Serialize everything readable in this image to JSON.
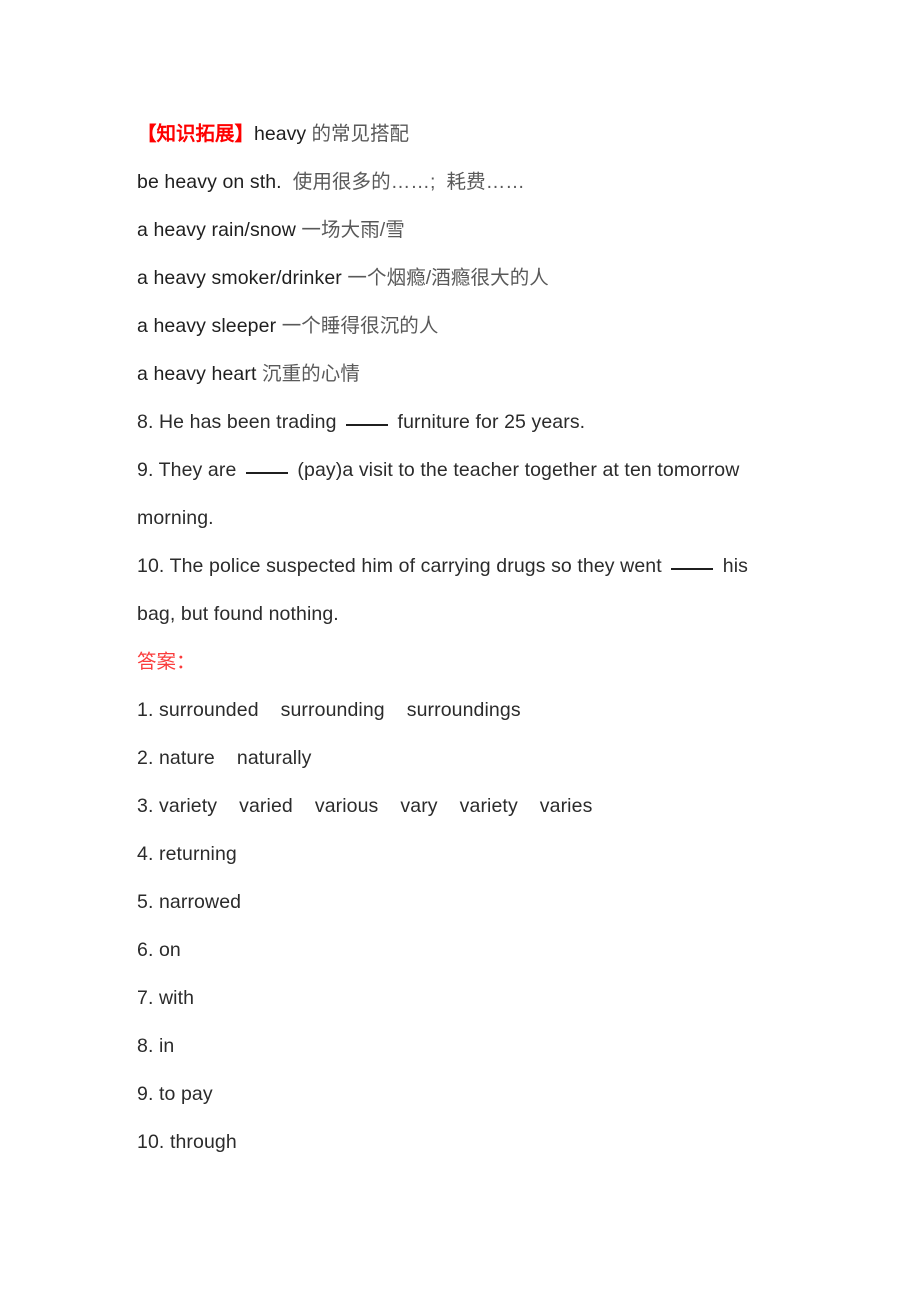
{
  "document": {
    "background_color": "#ffffff",
    "text_color": "#2b2b2b",
    "accent_red": "#ff0000",
    "answer_red": "#fa3c3c"
  },
  "knowledge_note": {
    "bracket_open": "【",
    "label": "知识拓展",
    "bracket_close": "】",
    "title_en": "heavy",
    "title_zh": " 的常见搭配",
    "collocations": [
      {
        "en": "be heavy on sth.",
        "zh": "  使用很多的……;  耗费……"
      },
      {
        "en": "a heavy rain/snow",
        "zh": " 一场大雨/雪"
      },
      {
        "en": "a heavy smoker/drinker",
        "zh": " 一个烟瘾/酒瘾很大的人"
      },
      {
        "en": "a heavy sleeper",
        "zh": " 一个睡得很沉的人"
      },
      {
        "en": "a heavy heart",
        "zh": " 沉重的心情"
      }
    ]
  },
  "questions": [
    {
      "number": "8.",
      "part1": " He has been trading ",
      "part2": " furniture for 25 years.",
      "part3": ""
    },
    {
      "number": "9.",
      "part1": " They are ",
      "part2": " (pay)a visit to the teacher together at ten tomorrow",
      "part3": "morning."
    },
    {
      "number": "10.",
      "part1": " The police suspected him of carrying drugs so they went ",
      "part2": " his",
      "part3": "bag, but found nothing."
    }
  ],
  "answers": {
    "heading": "答案：",
    "items": [
      {
        "number": "1.",
        "values": [
          "surrounded",
          "surrounding",
          "surroundings"
        ]
      },
      {
        "number": "2.",
        "values": [
          "nature",
          "naturally"
        ]
      },
      {
        "number": "3.",
        "values": [
          "variety",
          "varied",
          "various",
          "vary",
          "variety",
          "varies"
        ]
      },
      {
        "number": "4.",
        "values": [
          "returning"
        ]
      },
      {
        "number": "5.",
        "values": [
          "narrowed"
        ]
      },
      {
        "number": "6.",
        "values": [
          "on"
        ]
      },
      {
        "number": "7.",
        "values": [
          "with"
        ]
      },
      {
        "number": "8.",
        "values": [
          "in"
        ]
      },
      {
        "number": "9.",
        "values": [
          "to pay"
        ]
      },
      {
        "number": "10.",
        "values": [
          "through"
        ]
      }
    ]
  }
}
